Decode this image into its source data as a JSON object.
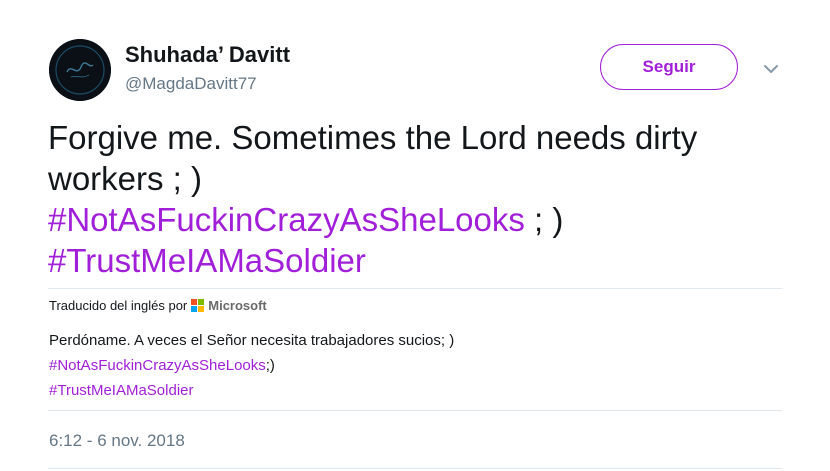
{
  "colors": {
    "accent": "#a11fd8",
    "secondary_text": "#657786",
    "primary_text": "#14171a",
    "divider": "#e1e8ed"
  },
  "author": {
    "display_name": "Shuhada’ Davitt",
    "handle": "@MagdaDavitt77",
    "avatar_icon": "profile-avatar"
  },
  "actions": {
    "follow_label": "Seguir",
    "more_icon": "chevron-down-icon"
  },
  "tweet": {
    "line1": "Forgive me. Sometimes the Lord needs dirty",
    "line2": "workers ; )",
    "hashtag1": "#NotAsFuckinCrazyAsSheLooks",
    "hashtag1_suffix": " ; )",
    "hashtag2": "#TrustMeIAMaSoldier"
  },
  "translation": {
    "translated_by_label": "Traducido del inglés por",
    "provider_name": "Microsoft",
    "provider_icon": "microsoft-logo-icon",
    "line1": "Perdóname. A veces el Señor necesita trabajadores sucios; )",
    "hashtag1": "#NotAsFuckinCrazyAsSheLooks",
    "hashtag1_suffix": ";)",
    "hashtag2": "#TrustMeIAMaSoldier"
  },
  "meta": {
    "timestamp": "6:12 - 6 nov. 2018"
  }
}
